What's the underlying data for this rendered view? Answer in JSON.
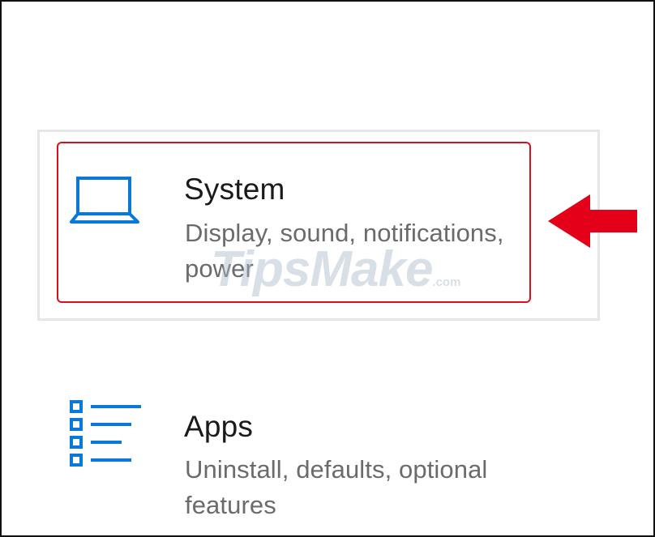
{
  "settings": {
    "items": [
      {
        "title": "System",
        "description": "Display, sound, notifications, power",
        "icon": "laptop-icon",
        "selected": true
      },
      {
        "title": "Apps",
        "description": "Uninstall, defaults, optional features",
        "icon": "apps-list-icon",
        "selected": false
      }
    ]
  },
  "watermark": {
    "text": "TipsMake",
    "suffix": ".com"
  },
  "colors": {
    "accent_blue": "#0a78d7",
    "highlight_red": "#d7101f",
    "arrow_red": "#e5001a"
  }
}
